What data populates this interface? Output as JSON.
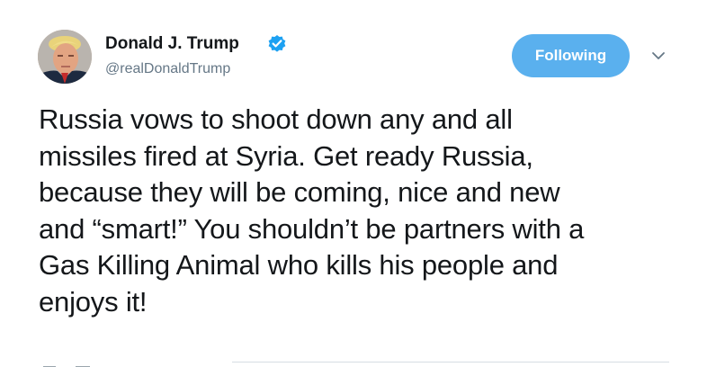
{
  "author": {
    "display_name": "Donald J. Trump",
    "handle": "@realDonaldTrump",
    "verified": true,
    "avatar_icon": "profile-photo"
  },
  "actions": {
    "follow_label": "Following",
    "menu_icon": "chevron-down-icon"
  },
  "tweet": {
    "lines": [
      "Russia vows to shoot down any and all",
      "missiles fired at Syria. Get ready Russia,",
      "because they will be coming, nice and new",
      "and “smart!” You shouldn’t be partners with a",
      "Gas Killing Animal who kills his people and",
      "enjoys it!"
    ]
  },
  "colors": {
    "accent": "#5ab0ee",
    "verified_badge": "#1da1f2",
    "text": "#14171a",
    "muted": "#657786"
  }
}
